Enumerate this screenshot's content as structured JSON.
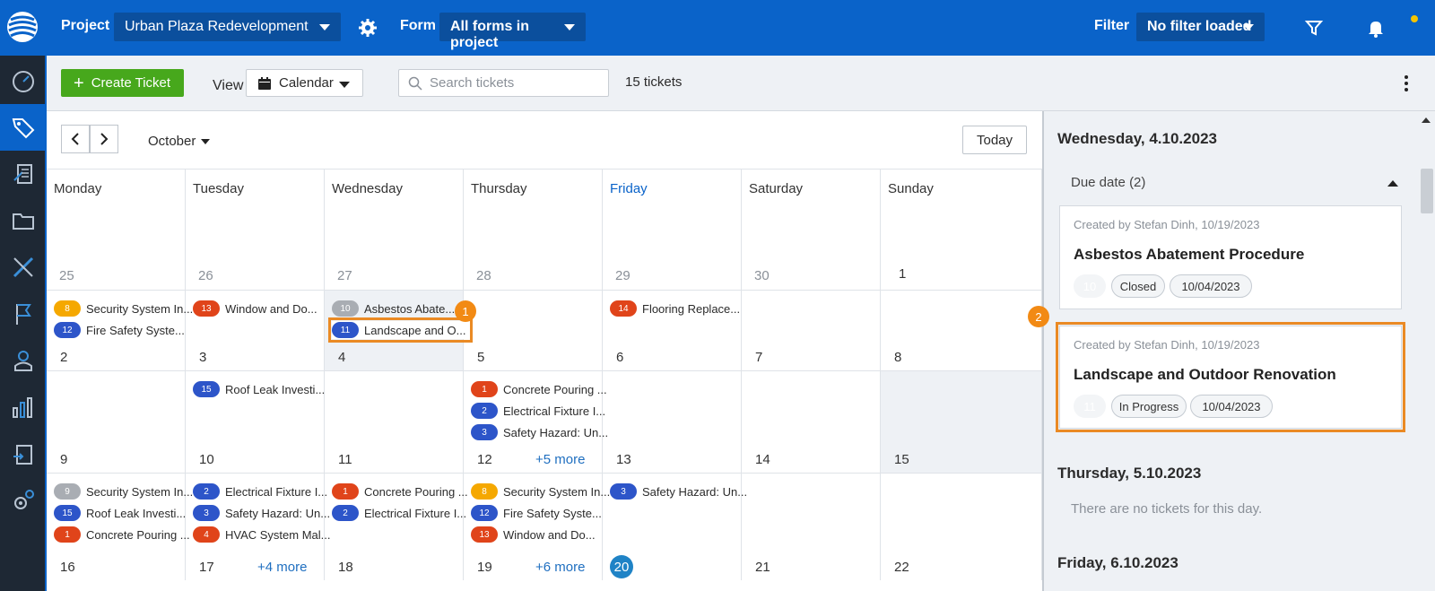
{
  "topbar": {
    "project_label": "Project",
    "project_value": "Urban Plaza Redevelopment",
    "form_label": "Form",
    "form_value": "All forms in project",
    "filter_label": "Filter",
    "filter_value": "No filter loaded"
  },
  "toolbar": {
    "create_label": "Create Ticket",
    "view_label": "View",
    "view_value": "Calendar",
    "search_placeholder": "Search tickets",
    "ticket_count": "15 tickets"
  },
  "calendar": {
    "month": "October",
    "today_label": "Today",
    "days": [
      "Monday",
      "Tuesday",
      "Wednesday",
      "Thursday",
      "Friday",
      "Saturday",
      "Sunday"
    ],
    "header_nums": [
      "25",
      "26",
      "27",
      "28",
      "29",
      "30",
      "1"
    ],
    "weeks": [
      {
        "cells": [
          {
            "day": "2",
            "tickets": [
              {
                "n": "8",
                "color": "orange",
                "t": "Security System In..."
              },
              {
                "n": "12",
                "color": "blue",
                "t": "Fire Safety Syste..."
              }
            ]
          },
          {
            "day": "3",
            "tickets": [
              {
                "n": "13",
                "color": "red",
                "t": "Window and Do..."
              }
            ]
          },
          {
            "day": "4",
            "tickets": [
              {
                "n": "10",
                "color": "gray",
                "t": "Asbestos Abate..."
              },
              {
                "n": "11",
                "color": "blue",
                "t": "Landscape and O..."
              }
            ]
          },
          {
            "day": "5",
            "tickets": []
          },
          {
            "day": "6",
            "tickets": [
              {
                "n": "14",
                "color": "red",
                "t": "Flooring Replace..."
              }
            ]
          },
          {
            "day": "7",
            "tickets": []
          },
          {
            "day": "8",
            "tickets": []
          }
        ]
      },
      {
        "cells": [
          {
            "day": "9",
            "tickets": []
          },
          {
            "day": "10",
            "tickets": [
              {
                "n": "15",
                "color": "blue",
                "t": "Roof Leak Investi..."
              }
            ]
          },
          {
            "day": "11",
            "tickets": []
          },
          {
            "day": "12",
            "more": "+5 more",
            "tickets": [
              {
                "n": "1",
                "color": "red",
                "t": "Concrete Pouring ..."
              },
              {
                "n": "2",
                "color": "blue",
                "t": "Electrical Fixture I..."
              },
              {
                "n": "3",
                "color": "blue",
                "t": "Safety Hazard: Un..."
              }
            ]
          },
          {
            "day": "13",
            "tickets": []
          },
          {
            "day": "14",
            "tickets": []
          },
          {
            "day": "15",
            "tickets": []
          }
        ]
      },
      {
        "cells": [
          {
            "day": "16",
            "tickets": [
              {
                "n": "9",
                "color": "gray",
                "t": "Security System In..."
              },
              {
                "n": "15",
                "color": "blue",
                "t": "Roof Leak Investi..."
              },
              {
                "n": "1",
                "color": "red",
                "t": "Concrete Pouring ..."
              }
            ]
          },
          {
            "day": "17",
            "more": "+4 more",
            "tickets": [
              {
                "n": "2",
                "color": "blue",
                "t": "Electrical Fixture I..."
              },
              {
                "n": "3",
                "color": "blue",
                "t": "Safety Hazard: Un..."
              },
              {
                "n": "4",
                "color": "red",
                "t": "HVAC System Mal..."
              }
            ]
          },
          {
            "day": "18",
            "tickets": [
              {
                "n": "1",
                "color": "red",
                "t": "Concrete Pouring ..."
              },
              {
                "n": "2",
                "color": "blue",
                "t": "Electrical Fixture I..."
              }
            ]
          },
          {
            "day": "19",
            "more": "+6 more",
            "tickets": [
              {
                "n": "8",
                "color": "orange",
                "t": "Security System In..."
              },
              {
                "n": "12",
                "color": "blue",
                "t": "Fire Safety Syste..."
              },
              {
                "n": "13",
                "color": "red",
                "t": "Window and Do..."
              }
            ]
          },
          {
            "day": "20",
            "today": true,
            "tickets": [
              {
                "n": "3",
                "color": "blue",
                "t": "Safety Hazard: Un..."
              }
            ]
          },
          {
            "day": "21",
            "tickets": []
          },
          {
            "day": "22",
            "tickets": []
          }
        ]
      }
    ]
  },
  "callouts": [
    "1",
    "2"
  ],
  "panel": {
    "date1": "Wednesday, 4.10.2023",
    "due_label": "Due date",
    "due_count": "(2)",
    "cards": [
      {
        "meta": "Created by Stefan Dinh, 10/19/2023",
        "title": "Asbestos Abatement Procedure",
        "num": "10",
        "status": "Closed",
        "date": "10/04/2023"
      },
      {
        "meta": "Created by Stefan Dinh, 10/19/2023",
        "title": "Landscape and Outdoor Renovation",
        "num": "11",
        "status": "In Progress",
        "date": "10/04/2023"
      }
    ],
    "date2": "Thursday, 5.10.2023",
    "empty": "There are no tickets for this day.",
    "date3": "Friday, 6.10.2023"
  },
  "colors": {
    "brand": "#0a63c9",
    "green": "#47a81c",
    "orange": "#f5a800",
    "blue": "#2d55c9",
    "red": "#e0441a",
    "gray": "#a9adb3",
    "highlight": "#ea8a24"
  }
}
